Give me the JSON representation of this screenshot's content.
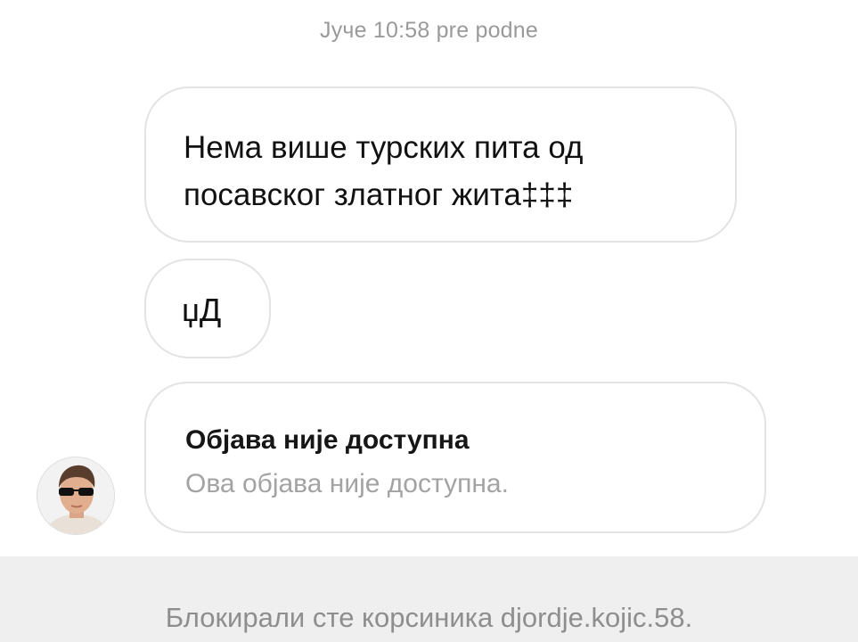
{
  "chat": {
    "timestamp": "Јуче 10:58 pre podne",
    "messages": [
      {
        "line1": "Нема више турских пита од",
        "line2": "посавског златног жита‡‡‡"
      },
      {
        "text": "џД"
      }
    ],
    "shared_post": {
      "title": "Објава није доступна",
      "description": "Ова објава није доступна."
    },
    "avatar_icon": "user-photo-avatar"
  },
  "footer": {
    "blocked_text": "Блокирали сте корсиника djordje.kojic.58."
  },
  "colors": {
    "background": "#ffffff",
    "bubble_border": "#e3e3e3",
    "muted_text": "#9a9a9a",
    "footer_bg": "#efefef"
  }
}
